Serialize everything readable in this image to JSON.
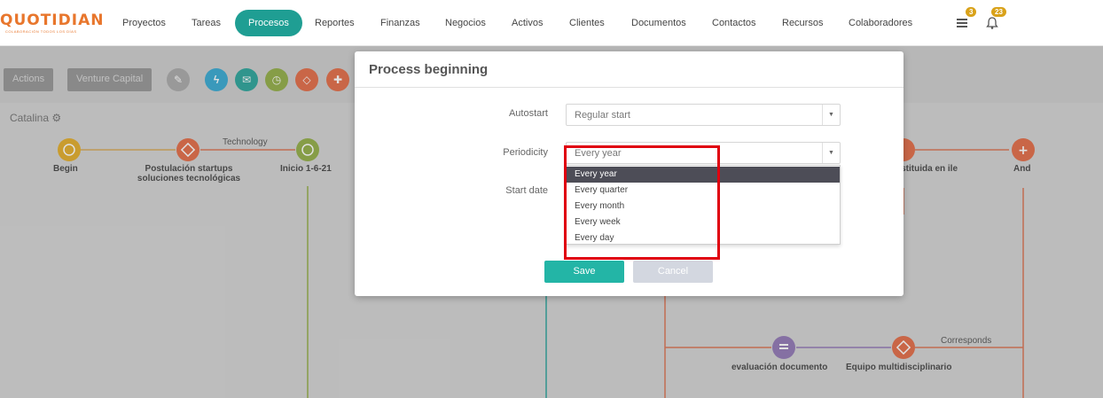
{
  "header": {
    "logo_text": "QUOTIDIAN",
    "logo_sub": "COLABORACIÓN TODOS LOS DÍAS",
    "nav": [
      {
        "label": "Proyectos"
      },
      {
        "label": "Tareas"
      },
      {
        "label": "Procesos"
      },
      {
        "label": "Reportes"
      },
      {
        "label": "Finanzas"
      },
      {
        "label": "Negocios"
      },
      {
        "label": "Activos"
      },
      {
        "label": "Clientes"
      },
      {
        "label": "Documentos"
      },
      {
        "label": "Contactos"
      },
      {
        "label": "Recursos"
      },
      {
        "label": "Colaboradores"
      }
    ],
    "active_nav": "Procesos",
    "tasks_badge": "3",
    "notifications_badge": "23"
  },
  "toolbar": {
    "actions_label": "Actions",
    "venture_label": "Venture Capital",
    "circle_icons": [
      "edit-icon",
      "bolt-icon",
      "email-icon",
      "clock-icon",
      "diamond-icon",
      "plus-icon"
    ],
    "colors": {
      "edit": "#a6a6a6",
      "bolt": "#2aa3cf",
      "email": "#1d9e94",
      "clock": "#8ba83a",
      "diamond": "#e0623a",
      "plus": "#e0623a"
    }
  },
  "canvas": {
    "lane_title": "Catalina",
    "nodes": [
      {
        "label": "Begin"
      },
      {
        "label": "Postulación startups soluciones tecnológicas"
      },
      {
        "label": "Inicio 1-6-21"
      },
      {
        "label": "nstituida en ile"
      },
      {
        "label": "And"
      },
      {
        "label": "evaluación documento"
      },
      {
        "label": "Equipo multidisciplinario"
      }
    ],
    "edges": [
      {
        "label": "Technology"
      },
      {
        "label": "Corresponds"
      }
    ]
  },
  "modal": {
    "title": "Process beginning",
    "fields": {
      "autostart": {
        "label": "Autostart",
        "value": "Regular start"
      },
      "periodicity": {
        "label": "Periodicity",
        "value": "Every year"
      },
      "start_date": {
        "label": "Start date"
      }
    },
    "periodicity_options": [
      "Every year",
      "Every quarter",
      "Every month",
      "Every week",
      "Every day"
    ],
    "selected_option": "Every year",
    "save_label": "Save",
    "cancel_label": "Cancel"
  }
}
